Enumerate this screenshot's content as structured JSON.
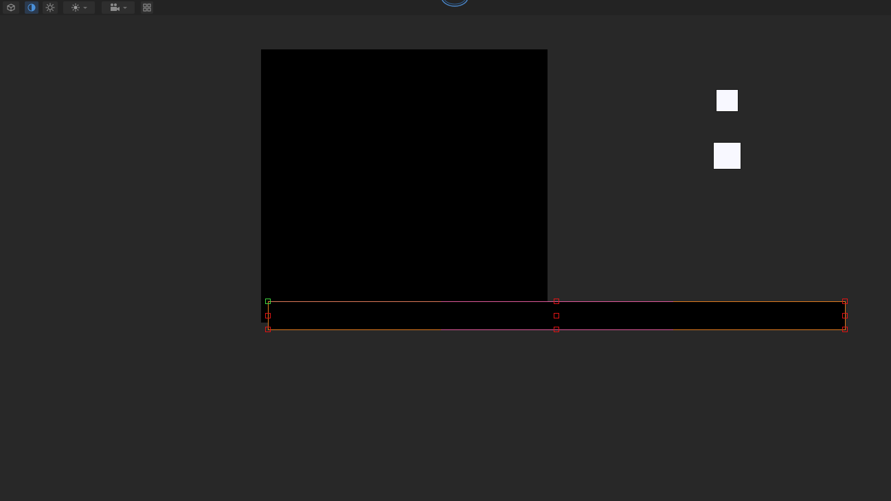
{
  "toolbar": {
    "buttons": [
      {
        "name": "cube-view-button",
        "icon": "cube-icon"
      },
      {
        "name": "shading-mode-button",
        "icon": "half-circle-icon",
        "active": true
      },
      {
        "name": "lighting-button",
        "icon": "sun-icon"
      },
      {
        "name": "lighting-dropdown",
        "icon": "sun-dropdown-icon"
      },
      {
        "name": "camera-dropdown",
        "icon": "camera-icon"
      },
      {
        "name": "grid-view-button",
        "icon": "grid-icon"
      }
    ]
  },
  "gizmo": {
    "icon": "orbit-gizmo-icon"
  },
  "colors": {
    "background": "#282828",
    "toolbar": "#232323",
    "selection_handle": "#e01414",
    "anchor_handle": "#3ed63e",
    "edge_orange": "#e07a1e",
    "edge_pink": "#e05a9a"
  }
}
